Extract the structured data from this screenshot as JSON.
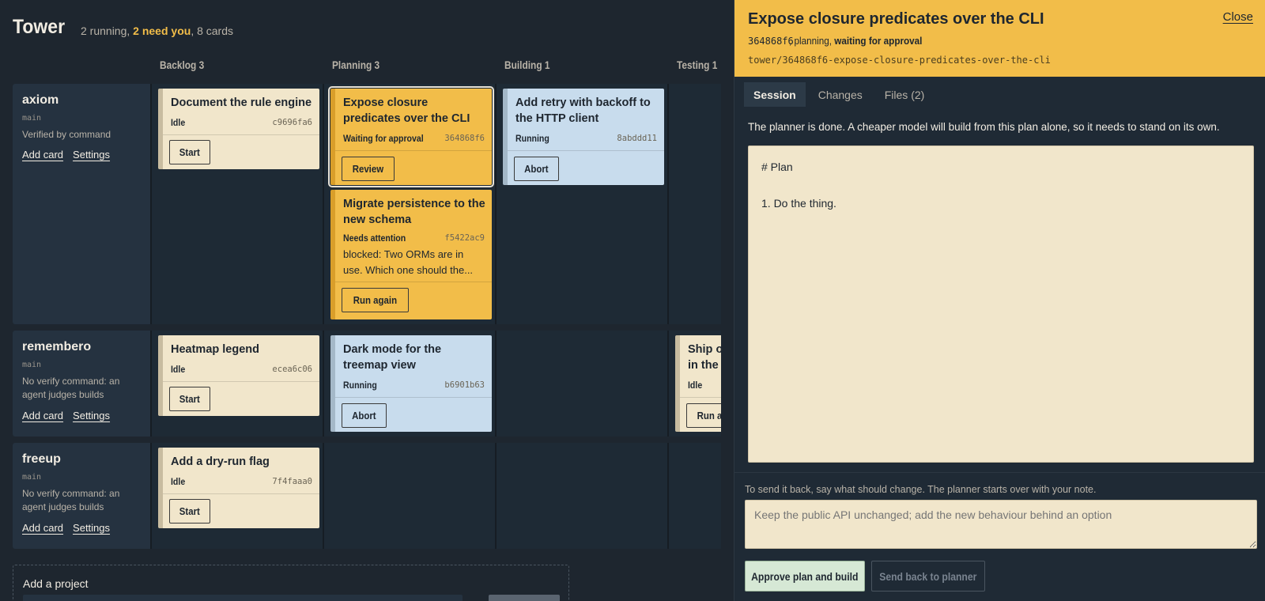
{
  "header": {
    "title": "Tower",
    "stats_running": "2 running, ",
    "stats_need": "2 need you",
    "stats_cards": ", 8 cards"
  },
  "columns": [
    "Backlog 3",
    "Planning 3",
    "Building 1",
    "Testing 1"
  ],
  "projects": [
    {
      "name": "axiom",
      "branch": "main",
      "verify": "Verified by command",
      "add_card": "Add card",
      "settings": "Settings"
    },
    {
      "name": "remembero",
      "branch": "main",
      "verify": "No verify command: an agent judges builds",
      "add_card": "Add card",
      "settings": "Settings"
    },
    {
      "name": "freeup",
      "branch": "main",
      "verify": "No verify command: an agent judges builds",
      "add_card": "Add card",
      "settings": "Settings"
    }
  ],
  "cards": {
    "doc_rule": {
      "title": "Document the rule engine",
      "status": "Idle",
      "hash": "c9696fa6",
      "action": "Start"
    },
    "expose": {
      "title": "Expose closure predicates over the CLI",
      "status": "Waiting for approval",
      "hash": "364868f6",
      "action": "Review"
    },
    "migrate": {
      "title": "Migrate persistence to the new schema",
      "status": "Needs attention",
      "hash": "f5422ac9",
      "blocked": "blocked: Two ORMs are in use. Which one should the...",
      "action": "Run again"
    },
    "retry": {
      "title": "Add retry with backoff to the HTTP client",
      "status": "Running",
      "hash": "8abddd11",
      "action": "Abort"
    },
    "heatmap": {
      "title": "Heatmap legend",
      "status": "Idle",
      "hash": "ecea6c06",
      "action": "Start"
    },
    "darkmode": {
      "title": "Dark mode for the treemap view",
      "status": "Running",
      "hash": "b6901b63",
      "action": "Abort"
    },
    "ship": {
      "title": "Ship o",
      "title2": "in the",
      "status": "Idle",
      "action": "Run ag"
    },
    "dryrun": {
      "title": "Add a dry-run flag",
      "status": "Idle",
      "hash": "7f4faaa0",
      "action": "Start"
    }
  },
  "add_project": {
    "label": "Add a project"
  },
  "panel": {
    "title": "Expose closure predicates over the CLI",
    "close": "Close",
    "meta_hash": "364868f6",
    "meta_mid": ", planning, ",
    "meta_state": "waiting for approval",
    "branch": "tower/364868f6-expose-closure-predicates-over-the-cli",
    "tabs": [
      "Session",
      "Changes",
      "Files (2)"
    ],
    "intro": "The planner is done. A cheaper model will build from this plan alone, so it needs to stand on its own.",
    "plan_heading": "# Plan",
    "plan_item": "1. Do the thing.",
    "send_note": "To send it back, say what should change. The planner starts over with your note.",
    "placeholder": "Keep the public API unchanged; add the new behaviour behind an option",
    "approve": "Approve plan and build",
    "send_back": "Send back to planner"
  },
  "colors": {
    "accent": "#f2bd49",
    "idle_card": "#f1e6cb",
    "running_card": "#c8dced",
    "background": "#1e262f"
  }
}
